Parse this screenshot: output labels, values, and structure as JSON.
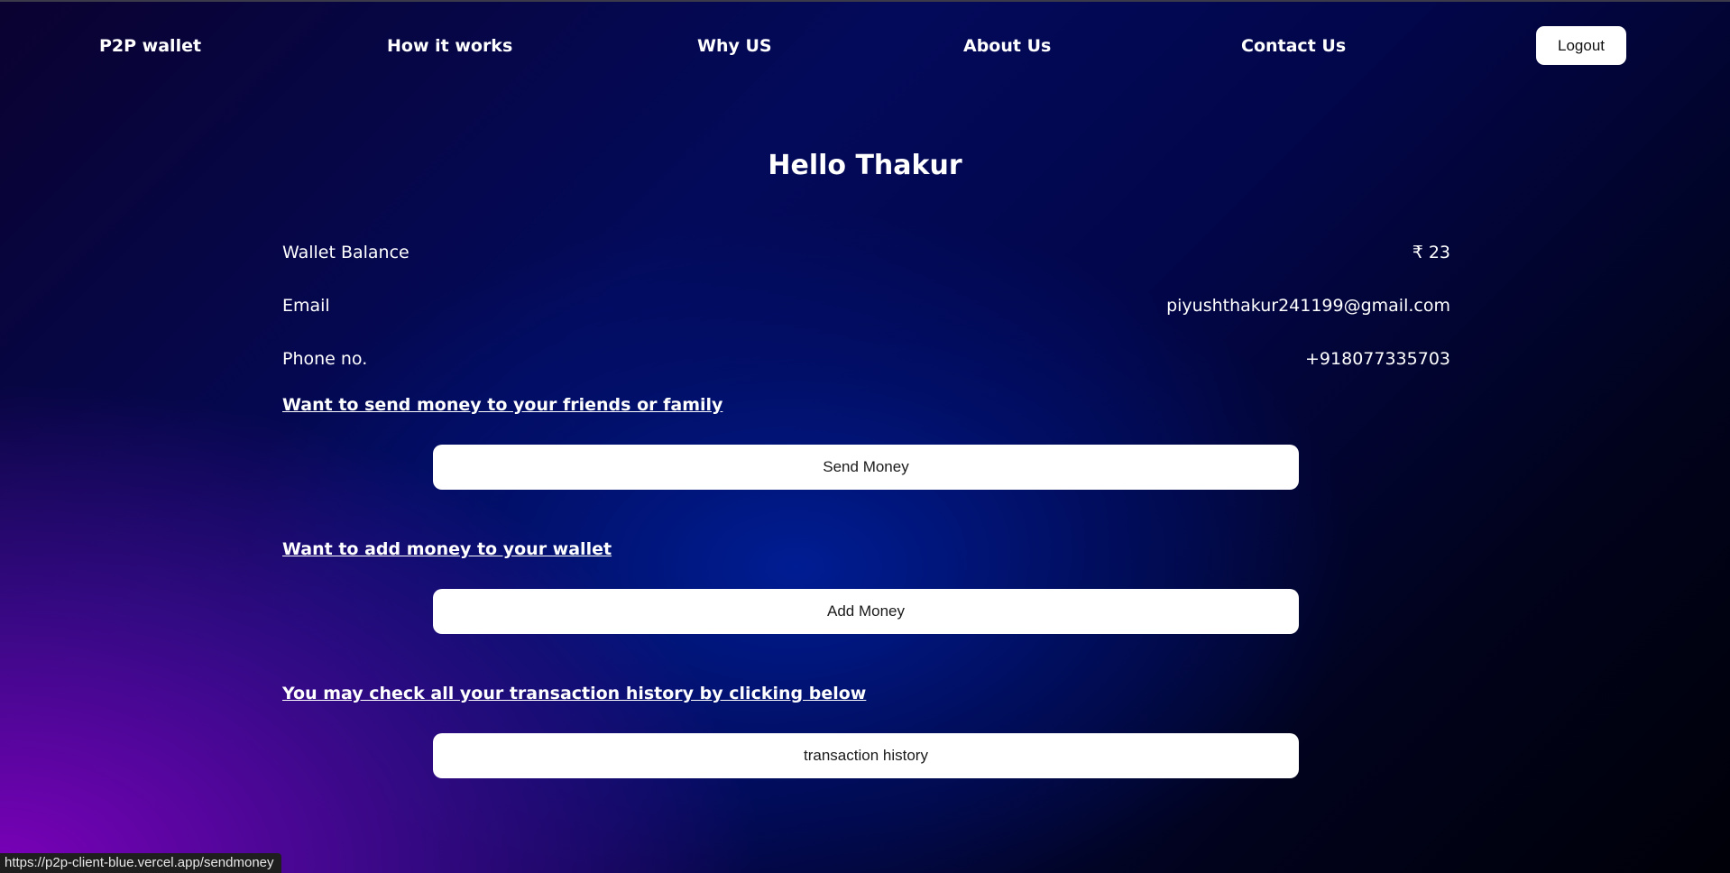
{
  "nav": {
    "brand": "P2P wallet",
    "how_it_works": "How it works",
    "why_us": "Why US",
    "about_us": "About Us",
    "contact_us": "Contact Us",
    "logout": "Logout"
  },
  "greeting": "Hello Thakur",
  "profile": {
    "balance_label": "Wallet Balance",
    "balance_value": "₹ 23",
    "email_label": "Email",
    "email_value": "piyushthakur241199@gmail.com",
    "phone_label": "Phone no.",
    "phone_value": "+918077335703"
  },
  "sections": {
    "send": {
      "prompt": "Want to send money to your friends or family",
      "button": "Send Money"
    },
    "add": {
      "prompt": "Want to add money to your wallet",
      "button": "Add Money"
    },
    "history": {
      "prompt": "You may check all your transaction history by clicking below",
      "button": "transaction history"
    }
  },
  "status_bar": {
    "url": "https://p2p-client-blue.vercel.app/sendmoney"
  }
}
